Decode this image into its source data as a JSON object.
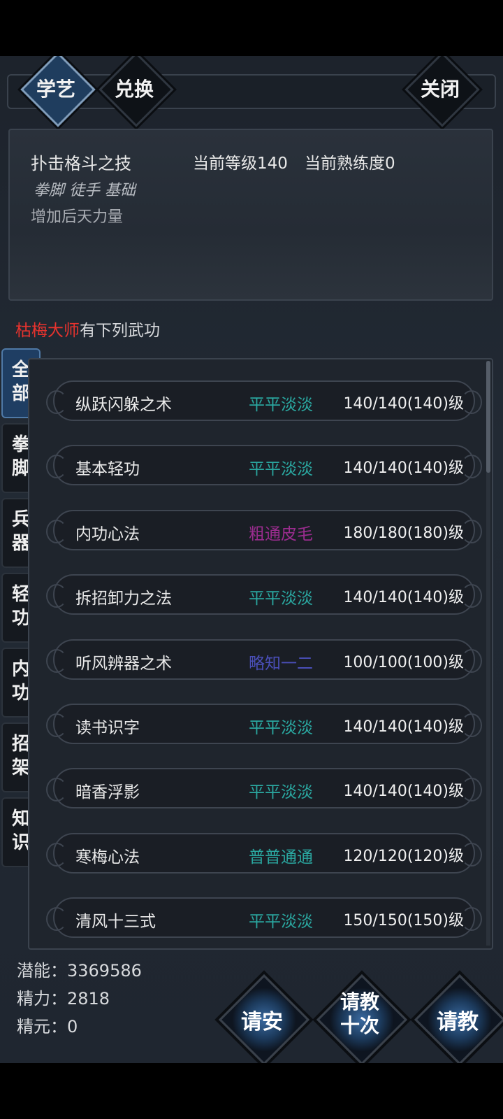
{
  "tabs_top": {
    "learn": "学艺",
    "exchange": "兑换",
    "close": "关闭"
  },
  "skill_info": {
    "name": "扑击格斗之技",
    "level": "当前等级140",
    "proficiency": "当前熟练度0",
    "tags": "拳脚 徒手 基础",
    "description": "增加后天力量"
  },
  "master": {
    "name": "枯梅大师",
    "suffix": "有下列武功"
  },
  "categories": [
    {
      "label": "全\n部",
      "active": true
    },
    {
      "label": "拳\n脚",
      "active": false
    },
    {
      "label": "兵\n器",
      "active": false
    },
    {
      "label": "轻\n功",
      "active": false
    },
    {
      "label": "内\n功",
      "active": false
    },
    {
      "label": "招\n架",
      "active": false
    },
    {
      "label": "知\n识",
      "active": false
    }
  ],
  "skills": [
    {
      "name": "纵跃闪躲之术",
      "rank": "平平淡淡",
      "rank_color": "#2aa7a0",
      "level": "140/140(140)级"
    },
    {
      "name": "基本轻功",
      "rank": "平平淡淡",
      "rank_color": "#2aa7a0",
      "level": "140/140(140)级"
    },
    {
      "name": "内功心法",
      "rank": "粗通皮毛",
      "rank_color": "#9b2c8f",
      "level": "180/180(180)级"
    },
    {
      "name": "拆招卸力之法",
      "rank": "平平淡淡",
      "rank_color": "#2aa7a0",
      "level": "140/140(140)级"
    },
    {
      "name": "听风辨器之术",
      "rank": "略知一二",
      "rank_color": "#4a4fb8",
      "level": "100/100(100)级"
    },
    {
      "name": "读书识字",
      "rank": "平平淡淡",
      "rank_color": "#2aa7a0",
      "level": "140/140(140)级"
    },
    {
      "name": "暗香浮影",
      "rank": "平平淡淡",
      "rank_color": "#2aa7a0",
      "level": "140/140(140)级"
    },
    {
      "name": "寒梅心法",
      "rank": "普普通通",
      "rank_color": "#2aa7a0",
      "level": "120/120(120)级"
    },
    {
      "name": "清风十三式",
      "rank": "平平淡淡",
      "rank_color": "#2aa7a0",
      "level": "150/150(150)级"
    }
  ],
  "stats": {
    "potential_label": "潜能：",
    "potential": "3369586",
    "energy_label": "精力：",
    "energy": "2818",
    "essence_label": "精元：",
    "essence": "0"
  },
  "actions": {
    "greet": "请安",
    "ask_ten": "请教\n十次",
    "ask": "请教"
  }
}
